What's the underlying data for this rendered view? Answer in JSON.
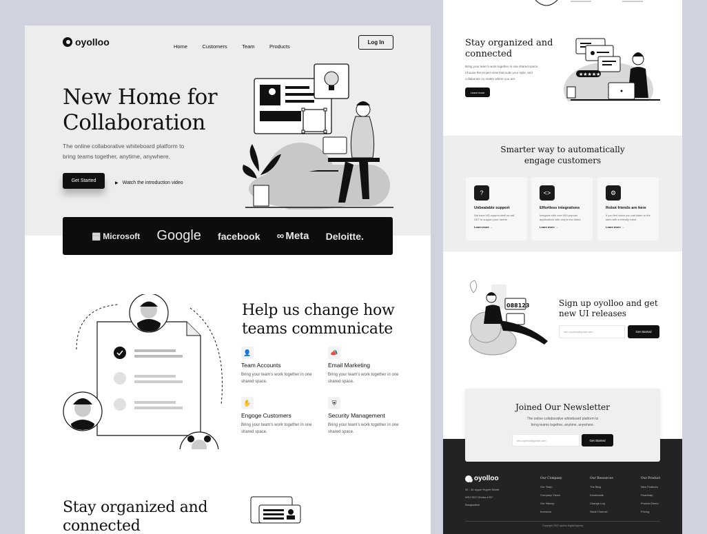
{
  "brand": {
    "name": "oyolloo"
  },
  "nav": {
    "items": [
      "Home",
      "Customers",
      "Team",
      "Products"
    ],
    "login": "Log In"
  },
  "hero": {
    "title_line1": "New Home for",
    "title_line2": "Collaboration",
    "subtitle_line1": "The online collaborative whiteboard platform to",
    "subtitle_line2": "bring teams together, anytime, anywhere.",
    "cta": "Get Started",
    "video": "Watch the introduction video"
  },
  "partners": [
    "Microsoft",
    "Google",
    "facebook",
    "Meta",
    "Deloitte."
  ],
  "help": {
    "title_line1": "Help us change how",
    "title_line2": "teams communicate",
    "features": [
      {
        "title": "Team Accounts",
        "desc": "Bring your team's work together in one shared space."
      },
      {
        "title": "Email Marketing",
        "desc": "Bring your team's work together in one shared space."
      },
      {
        "title": "Engoge Customers",
        "desc": "Bring your team's work together in one shared space."
      },
      {
        "title": "Security Management",
        "desc": "Bring your team's work together in one shared space."
      }
    ]
  },
  "stay_left": {
    "title_line1": "Stay organized and",
    "title_line2": "connected"
  },
  "stay": {
    "title_line1": "Stay organized and",
    "title_line2": "connected",
    "desc_line1": "Bring your team's work together in one shared space.",
    "desc_line2": "Choose the project view that suits your style, and",
    "desc_line3": "collaborate no matter where you are.",
    "cta": "Learn more"
  },
  "smarter": {
    "title_line1": "Smarter way to automatically",
    "title_line2": "engage customers",
    "cards": [
      {
        "title": "Unbeatable support",
        "desc": "We have HD support staff on call 24/7 to support your needs.",
        "link": "Learn more"
      },
      {
        "title": "Effortless integrations",
        "desc": "Integrate with over 500 popular applications with only a few clicks.",
        "link": "Learn more"
      },
      {
        "title": "Robot friends are here",
        "desc": "If you feel down you can listen to the tales with a friendly robot.",
        "link": "Learn more"
      }
    ]
  },
  "signup": {
    "title_line1": "Sign up oyolloo and get",
    "title_line2": "new UI releases",
    "placeholder": "info.oyolloo@gmail.com",
    "cta": "Get Started",
    "screen_number": "088123"
  },
  "newsletter": {
    "title": "Joined Our Newsletter",
    "desc_line1": "The online collaborative whiteboard platform to",
    "desc_line2": "bring teams together, anytime, anywhere.",
    "placeholder": "info.oyolloo@gmail.com",
    "cta": "Get Started"
  },
  "footer": {
    "address_line1": "32 - 44 Upper Rupert Street",
    "address_line2": "WSJ 9DY Dhaka-1207",
    "address_line3": "Bangladesh",
    "columns": [
      {
        "title": "Our Company",
        "items": [
          "Our Team",
          "Company Vision",
          "Our History",
          "Investors"
        ]
      },
      {
        "title": "Our Resources",
        "items": [
          "The Blog",
          "Downloads",
          "Change Log",
          "Slack Channel"
        ]
      },
      {
        "title": "Our Product",
        "items": [
          "New Features",
          "Roadmap",
          "Product Demo",
          "Pricing"
        ]
      }
    ],
    "copyright": "Copyright 2022 oyolloo Digital Agency"
  },
  "colors": {
    "dark": "#111111",
    "hero_bg": "#ededed",
    "page_bg": "#d0d3dd"
  }
}
